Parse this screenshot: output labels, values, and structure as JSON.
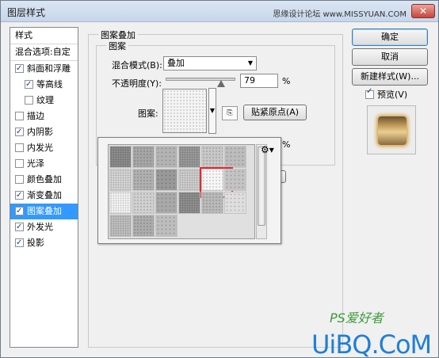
{
  "window": {
    "title": "图层样式",
    "watermark": "思缘设计论坛 www.MISSYUAN.COM",
    "close_icon": "close-icon"
  },
  "style_list": {
    "header_label": "样式",
    "blend_options_label": "混合选项:自定",
    "items": [
      {
        "label": "斜面和浮雕",
        "checked": true,
        "indent": false
      },
      {
        "label": "等高线",
        "checked": true,
        "indent": true
      },
      {
        "label": "纹理",
        "checked": false,
        "indent": true
      },
      {
        "label": "描边",
        "checked": false,
        "indent": false
      },
      {
        "label": "内阴影",
        "checked": true,
        "indent": false
      },
      {
        "label": "内发光",
        "checked": false,
        "indent": false
      },
      {
        "label": "光泽",
        "checked": false,
        "indent": false
      },
      {
        "label": "颜色叠加",
        "checked": false,
        "indent": false
      },
      {
        "label": "渐变叠加",
        "checked": true,
        "indent": false
      },
      {
        "label": "图案叠加",
        "checked": true,
        "indent": false,
        "selected": true
      },
      {
        "label": "外发光",
        "checked": true,
        "indent": false
      },
      {
        "label": "投影",
        "checked": true,
        "indent": false
      }
    ]
  },
  "panel": {
    "group_title": "图案叠加",
    "inner_title": "图案",
    "blend_mode_label": "混合模式(B):",
    "blend_mode_value": "叠加",
    "opacity_label": "不透明度(Y):",
    "opacity_value": "79",
    "opacity_unit": "%",
    "opacity_fraction": 0.79,
    "pattern_label": "图案:",
    "snap_origin_button": "贴紧原点(A)",
    "partial_percent": "%"
  },
  "buttons": {
    "ok": "确定",
    "cancel": "取消",
    "new_style": "新建样式(W)...",
    "preview_label": "预览(V)",
    "preview_checked": true
  },
  "picker": {
    "gear_icon": "gear-icon",
    "selected_index": 10,
    "swatches": [
      "#8c8c8c",
      "#a6a6a6",
      "#b3b3b3",
      "#9a9a9a",
      "#c8c8c8",
      "#bcbcbc",
      "#d6d6d6",
      "#b0b0b0",
      "#999999",
      "#cfcfcf",
      "#f7f7f7",
      "#c3c3c3",
      "#f4f4f4",
      "#d0d0d0",
      "#a9a9a9",
      "#8f8f8f",
      "#b9b9b9",
      "#dedede",
      "#c0c0c0",
      "#acacac",
      "#bdbdbd"
    ]
  },
  "brand": {
    "ps_text": "PS爱好者",
    "main_text": "UiBQ.CoM"
  }
}
